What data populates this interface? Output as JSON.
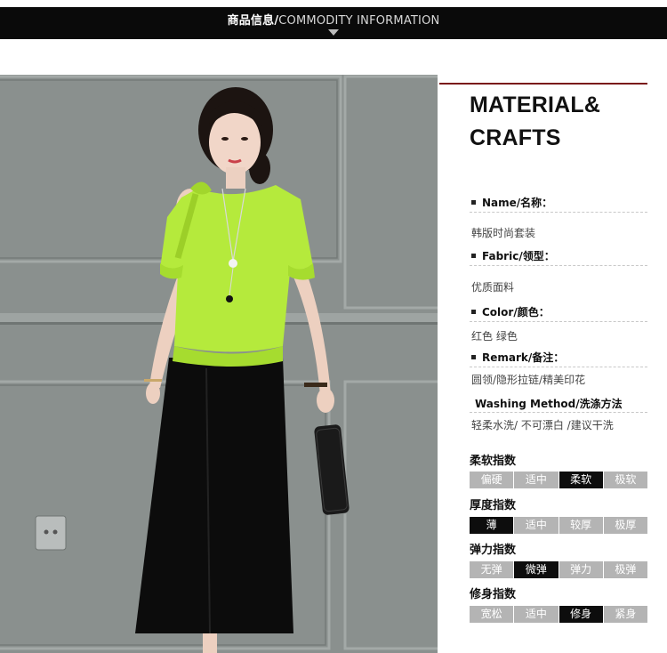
{
  "header": {
    "title_cn": "商品信息/",
    "title_en": "COMMODITY INFORMATION"
  },
  "panel": {
    "heading_line1": "MATERIAL&",
    "heading_line2": "CRAFTS"
  },
  "details": [
    {
      "label": "Name/名称：",
      "value": "韩版时尚套装"
    },
    {
      "label": "Fabric/领型：",
      "value": "优质面料"
    },
    {
      "label": "Color/颜色：",
      "value": "红色  绿色"
    },
    {
      "label": "Remark/备注：",
      "value": "圆领/隐形拉链/精美印花"
    },
    {
      "label": "Washing Method/洗涤方法",
      "value": "轻柔水洗/ 不可漂白 /建议干洗"
    }
  ],
  "indices": [
    {
      "title": "柔软指数",
      "options": [
        "偏硬",
        "适中",
        "柔软",
        "极软"
      ],
      "selected": "柔软"
    },
    {
      "title": "厚度指数",
      "options": [
        "薄",
        "适中",
        "较厚",
        "极厚"
      ],
      "selected": "薄"
    },
    {
      "title": "弹力指数",
      "options": [
        "无弹",
        "微弹",
        "弹力",
        "极弹"
      ],
      "selected": "微弹"
    },
    {
      "title": "修身指数",
      "options": [
        "宽松",
        "适中",
        "修身",
        "紧身"
      ],
      "selected": "修身"
    }
  ],
  "colors": {
    "top_bar": "#0a0a0a",
    "accent_line": "#7a1a1a",
    "blouse": "#b5ea3c",
    "wall": "#8c9290",
    "selected_cell": "#0d0d0d",
    "cell": "#b4b4b4"
  }
}
